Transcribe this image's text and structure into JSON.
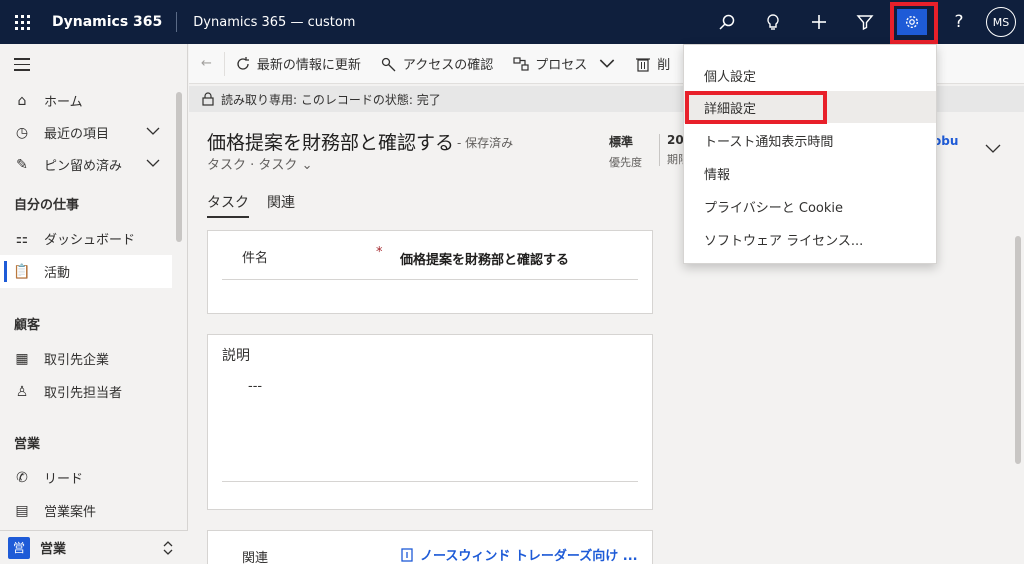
{
  "topbar": {
    "brand": "Dynamics 365",
    "app_name": "Dynamics 365 — custom",
    "avatar_initials": "MS",
    "icons": [
      "search-icon",
      "lightbulb-icon",
      "plus-icon",
      "filter-icon",
      "gear-icon",
      "help-icon"
    ]
  },
  "sidebar": {
    "items_top": [
      {
        "label": "ホーム",
        "icon": "home-icon"
      },
      {
        "label": "最近の項目",
        "icon": "clock-icon"
      },
      {
        "label": "ピン留め済み",
        "icon": "pin-icon"
      }
    ],
    "group_mywork": "自分の仕事",
    "mywork_items": [
      {
        "label": "ダッシュボード",
        "icon": "dashboard-icon"
      },
      {
        "label": "活動",
        "icon": "activity-icon"
      }
    ],
    "group_customer": "顧客",
    "customer_items": [
      {
        "label": "取引先企業",
        "icon": "building-icon"
      },
      {
        "label": "取引先担当者",
        "icon": "person-icon"
      }
    ],
    "group_sales": "営業",
    "sales_items": [
      {
        "label": "リード",
        "icon": "phone-icon"
      },
      {
        "label": "営業案件",
        "icon": "opportunity-icon"
      }
    ],
    "area_badge": "営",
    "area_label": "営業"
  },
  "commandbar": {
    "refresh": "最新の情報に更新",
    "access": "アクセスの確認",
    "process": "プロセス",
    "delete_partial": "削"
  },
  "banner": {
    "text": "読み取り専用: このレコードの状態: 完了"
  },
  "record": {
    "title": "価格提案を財務部と確認する",
    "saved_status": "- 保存済み",
    "entity_type": "タスク",
    "form_name": "タスク",
    "priority_value": "標準",
    "priority_label": "優先度",
    "date_value_partial": "20",
    "date_label_partial": "期限",
    "owner_partial": "obu"
  },
  "tabs": [
    "タスク",
    "関連"
  ],
  "form": {
    "subject_label": "件名",
    "required_mark": "*",
    "subject_value": "価格提案を財務部と確認する",
    "description_label": "説明",
    "description_value": "---",
    "regarding_label": "関連",
    "regarding_value": "ノースウィンド トレーダーズ向け ..."
  },
  "settings_menu": {
    "items": [
      "個人設定",
      "詳細設定",
      "トースト通知表示時間",
      "情報",
      "プライバシーと Cookie",
      "ソフトウェア ライセンス..."
    ],
    "highlighted_index": 1
  }
}
